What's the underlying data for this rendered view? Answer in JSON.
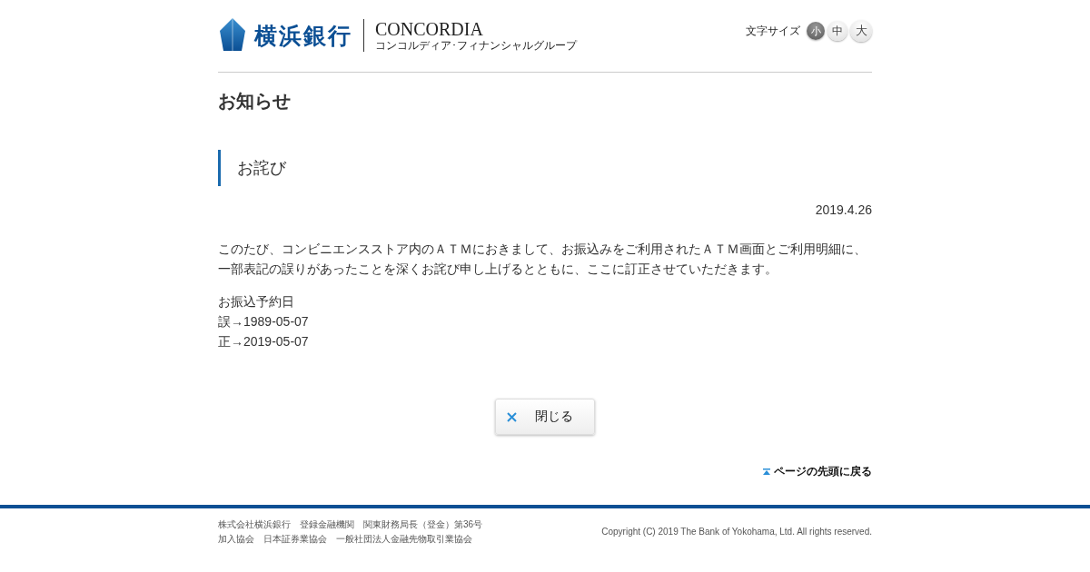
{
  "header": {
    "bank_name": "横浜銀行",
    "group_name": "CONCORDIA",
    "group_subtitle": "コンコルディア･フィナンシャルグループ",
    "font_size": {
      "label": "文字サイズ",
      "options": [
        {
          "label": "小",
          "selected": true
        },
        {
          "label": "中",
          "selected": false
        },
        {
          "label": "大",
          "selected": false
        }
      ]
    }
  },
  "page_title": "お知らせ",
  "notice": {
    "heading": "お詫び",
    "date": "2019.4.26",
    "body_lines": [
      "このたび、コンビニエンスストア内のＡＴＭにおきまして、お振込みをご利用されたＡＴＭ画面とご利用明細に、",
      "一部表記の誤りがあったことを深くお詫び申し上げるとともに、ここに訂正させていただきます。"
    ],
    "details": [
      "お振込予約日",
      "誤→1989-05-07",
      "正→2019-05-07"
    ]
  },
  "close_button": {
    "label": "閉じる"
  },
  "back_to_top": "ページの先頭に戻る",
  "footer": {
    "lines": [
      "株式会社横浜銀行　登録金融機関　関東財務局長（登金）第36号",
      "加入協会　日本証券業協会　一般社団法人金融先物取引業協会"
    ],
    "copyright": "Copyright (C) 2019 The Bank of Yokohama, Ltd. All rights reserved."
  }
}
